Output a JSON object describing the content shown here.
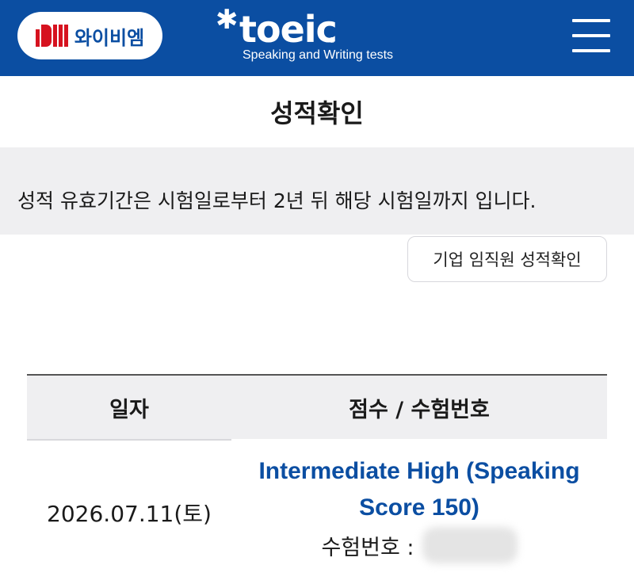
{
  "header": {
    "ybm_brand": "YBM",
    "ybm_label": "와이비엠",
    "toeic_star": "✱",
    "toeic_word": "toeic",
    "toeic_reg": "®",
    "toeic_subtitle": "Speaking and Writing tests",
    "menu_icon": "hamburger-menu-icon"
  },
  "page": {
    "title": "성적확인"
  },
  "notice": {
    "text": "성적 유효기간은 시험일로부터 2년 뒤 해당 시험일까지 입니다."
  },
  "corp_button": {
    "label": "기업 임직원 성적확인"
  },
  "table": {
    "headers": [
      "일자",
      "점수 / 수험번호"
    ],
    "rows": [
      {
        "date": "2026.07.11(토)",
        "score_line1": "Intermediate High (Speaking",
        "score_line2": "Score 150)",
        "exam_label": "수험번호 :"
      }
    ]
  },
  "colors": {
    "brand_blue": "#0b4ea2",
    "ybm_red": "#d6121f",
    "notice_bg": "#efeff1"
  }
}
